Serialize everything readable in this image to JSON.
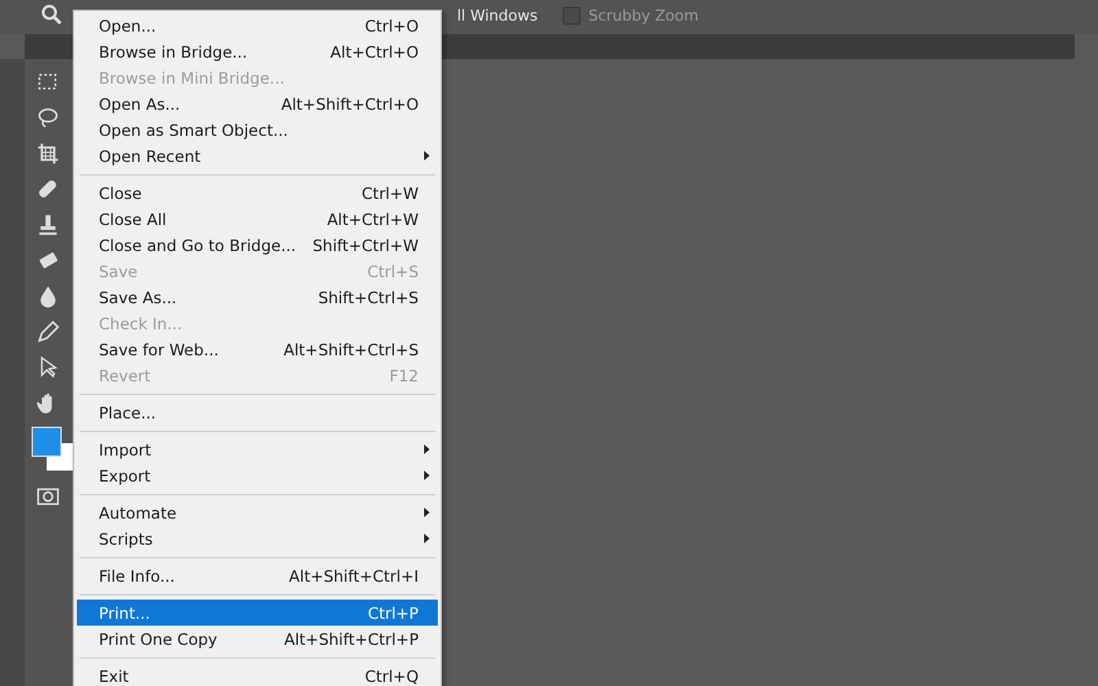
{
  "options_bar": {
    "partial_label": "ll Windows",
    "scrubby_zoom": {
      "label": "Scrubby Zoom",
      "checked": false
    }
  },
  "file_menu": [
    {
      "kind": "item",
      "label": "Open...",
      "shortcut": "Ctrl+O",
      "disabled": false,
      "submenu": false,
      "selected": false
    },
    {
      "kind": "item",
      "label": "Browse in Bridge...",
      "shortcut": "Alt+Ctrl+O",
      "disabled": false,
      "submenu": false,
      "selected": false
    },
    {
      "kind": "item",
      "label": "Browse in Mini Bridge...",
      "disabled": true,
      "submenu": false,
      "selected": false
    },
    {
      "kind": "item",
      "label": "Open As...",
      "shortcut": "Alt+Shift+Ctrl+O",
      "disabled": false,
      "submenu": false,
      "selected": false
    },
    {
      "kind": "item",
      "label": "Open as Smart Object...",
      "disabled": false,
      "submenu": false,
      "selected": false
    },
    {
      "kind": "item",
      "label": "Open Recent",
      "disabled": false,
      "submenu": true,
      "selected": false
    },
    {
      "kind": "separator"
    },
    {
      "kind": "item",
      "label": "Close",
      "shortcut": "Ctrl+W",
      "disabled": false,
      "submenu": false,
      "selected": false
    },
    {
      "kind": "item",
      "label": "Close All",
      "shortcut": "Alt+Ctrl+W",
      "disabled": false,
      "submenu": false,
      "selected": false
    },
    {
      "kind": "item",
      "label": "Close and Go to Bridge...",
      "shortcut": "Shift+Ctrl+W",
      "disabled": false,
      "submenu": false,
      "selected": false
    },
    {
      "kind": "item",
      "label": "Save",
      "shortcut": "Ctrl+S",
      "disabled": true,
      "submenu": false,
      "selected": false
    },
    {
      "kind": "item",
      "label": "Save As...",
      "shortcut": "Shift+Ctrl+S",
      "disabled": false,
      "submenu": false,
      "selected": false
    },
    {
      "kind": "item",
      "label": "Check In...",
      "disabled": true,
      "submenu": false,
      "selected": false
    },
    {
      "kind": "item",
      "label": "Save for Web...",
      "shortcut": "Alt+Shift+Ctrl+S",
      "disabled": false,
      "submenu": false,
      "selected": false
    },
    {
      "kind": "item",
      "label": "Revert",
      "shortcut": "F12",
      "disabled": true,
      "submenu": false,
      "selected": false
    },
    {
      "kind": "separator"
    },
    {
      "kind": "item",
      "label": "Place...",
      "disabled": false,
      "submenu": false,
      "selected": false
    },
    {
      "kind": "separator"
    },
    {
      "kind": "item",
      "label": "Import",
      "disabled": false,
      "submenu": true,
      "selected": false
    },
    {
      "kind": "item",
      "label": "Export",
      "disabled": false,
      "submenu": true,
      "selected": false
    },
    {
      "kind": "separator"
    },
    {
      "kind": "item",
      "label": "Automate",
      "disabled": false,
      "submenu": true,
      "selected": false
    },
    {
      "kind": "item",
      "label": "Scripts",
      "disabled": false,
      "submenu": true,
      "selected": false
    },
    {
      "kind": "separator"
    },
    {
      "kind": "item",
      "label": "File Info...",
      "shortcut": "Alt+Shift+Ctrl+I",
      "disabled": false,
      "submenu": false,
      "selected": false
    },
    {
      "kind": "separator"
    },
    {
      "kind": "item",
      "label": "Print...",
      "shortcut": "Ctrl+P",
      "disabled": false,
      "submenu": false,
      "selected": true
    },
    {
      "kind": "item",
      "label": "Print One Copy",
      "shortcut": "Alt+Shift+Ctrl+P",
      "disabled": false,
      "submenu": false,
      "selected": false
    },
    {
      "kind": "separator"
    },
    {
      "kind": "item",
      "label": "Exit",
      "shortcut": "Ctrl+Q",
      "disabled": false,
      "submenu": false,
      "selected": false
    }
  ]
}
